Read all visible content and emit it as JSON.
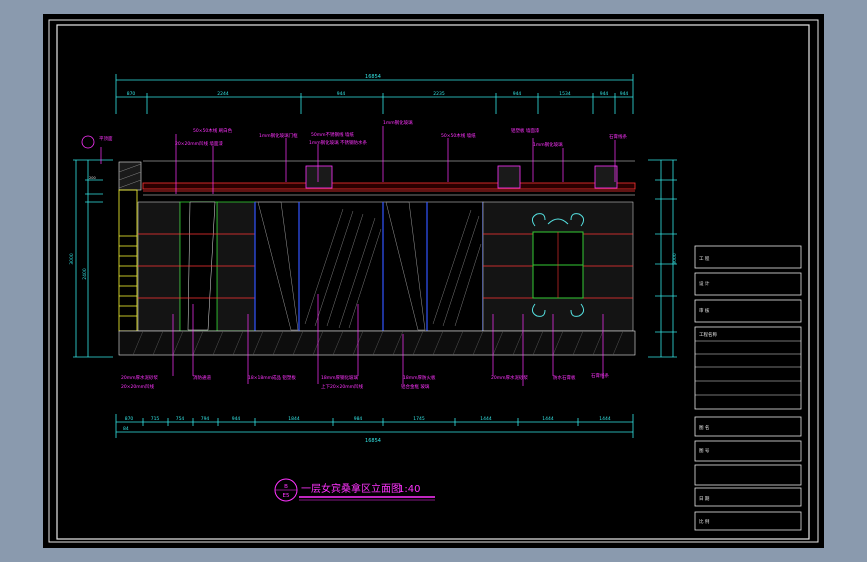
{
  "drawing": {
    "title_zh": "一层女宾桑拿区立面图",
    "scale": "1:40",
    "section_mark": "B",
    "section_sheet": "E5",
    "overall_dim": "16854",
    "top_dims": [
      "870",
      "2244",
      "944",
      "2235",
      "944",
      "1534",
      "944",
      "944"
    ],
    "bottom_dims": [
      "870",
      "715",
      "754",
      "794",
      "944",
      "1844",
      "984",
      "1745",
      "1444",
      "1444",
      "1444"
    ],
    "bottom_dim_left": "84",
    "top_labels": [
      "平顶面",
      "50×50木线 刷白色",
      "20×20mm凹线 墙面漆",
      "1mm钢化玻璃门框",
      "50mm不锈钢线 墙纸",
      "1mm钢化玻璃 不锈钢防水条",
      "1mm钢化玻璃",
      "50×50木线 墙纸",
      "铝塑板 墙面漆",
      "1mm钢化玻璃",
      "石膏线条"
    ],
    "bottom_labels": [
      "20mm厚水泥砂浆",
      "20×20mm凹线",
      "消防通道",
      "18×18mm成品 铝塑板",
      "18mm厚钢化玻璃",
      "上下20×20mm凹线",
      "18mm厚防火板",
      "铝合金框 玻璃",
      "20mm厚水泥砂浆",
      "防水石膏板",
      "石膏线条"
    ],
    "title_block_rows": [
      "工 程",
      "设 计",
      "审 核",
      "工程名称",
      "图 名",
      "图 号",
      "日 期",
      "比 例"
    ]
  },
  "colors": {
    "background": "#000000",
    "frame": "#e8e8e8",
    "dimension": "#33e6e6",
    "annotation": "#ff33ff",
    "wall_red": "#ff3333",
    "glass_blue": "#3355ff",
    "yellow": "#ffff33",
    "green": "#33cc33",
    "ornament": "#55e0e0"
  }
}
